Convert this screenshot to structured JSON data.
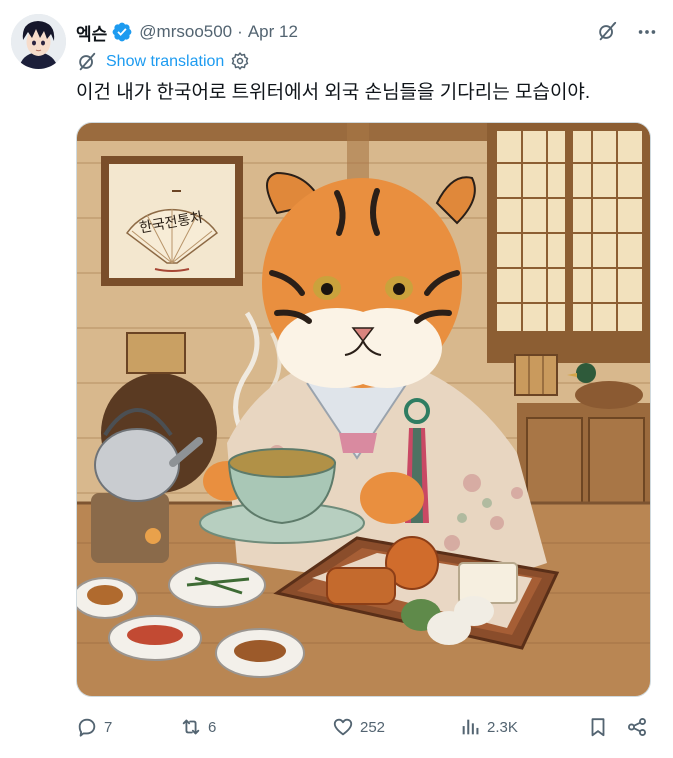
{
  "tweet": {
    "display_name": "엑슨",
    "handle": "@mrsoo500",
    "separator": "·",
    "date": "Apr 12",
    "translate_label": "Show translation",
    "text": "이건 내가 한국어로 트위터에서 외국 손님들을 기다리는 모습이야.",
    "image_fan_text": "한국전통차"
  },
  "actions": {
    "replies": "7",
    "reposts": "6",
    "likes": "252",
    "views": "2.3K"
  },
  "colors": {
    "verified": "#1d9bf0",
    "link": "#1d9bf0",
    "muted": "#536471",
    "text": "#0f1419"
  },
  "icons": [
    "verified-badge-icon",
    "grok-icon",
    "more-icon",
    "translate-icon",
    "settings-icon",
    "reply-icon",
    "repost-icon",
    "like-icon",
    "views-icon",
    "bookmark-icon",
    "share-icon"
  ]
}
